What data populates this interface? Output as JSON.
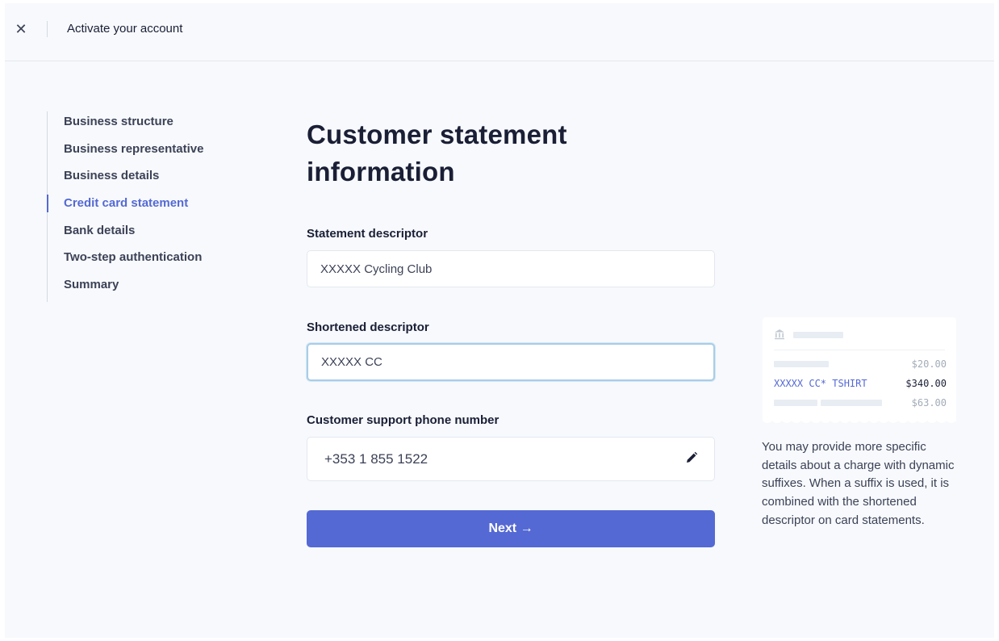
{
  "topbar": {
    "close_icon": "close-icon",
    "title": "Activate your account"
  },
  "steps": [
    {
      "label": "Business structure",
      "active": false
    },
    {
      "label": "Business representative",
      "active": false
    },
    {
      "label": "Business details",
      "active": false
    },
    {
      "label": "Credit card statement",
      "active": true
    },
    {
      "label": "Bank details",
      "active": false
    },
    {
      "label": "Two-step authentication",
      "active": false
    },
    {
      "label": "Summary",
      "active": false
    }
  ],
  "form": {
    "title_line1": "Customer statement",
    "title_line2": "information",
    "statement_descriptor_label": "Statement descriptor",
    "statement_descriptor_value": "XXXXX Cycling Club",
    "shortened_descriptor_label": "Shortened descriptor",
    "shortened_descriptor_value": "XXXXX CC",
    "phone_label": "Customer support phone number",
    "phone_value": "+353 1 855 1522",
    "next_label": "Next →"
  },
  "preview": {
    "amount1": "$20.00",
    "descriptor_line": "XXXXX CC* TSHIRT",
    "amount2": "$340.00",
    "amount3": "$63.00"
  },
  "help_text": "You may provide more specific details about a charge with dynamic suffixes. When a suffix is used, it is combined with the shortened descriptor on card statements.",
  "colors": {
    "accent": "#5469d4",
    "background": "#f7f9fc",
    "text": "#1a1f36"
  }
}
